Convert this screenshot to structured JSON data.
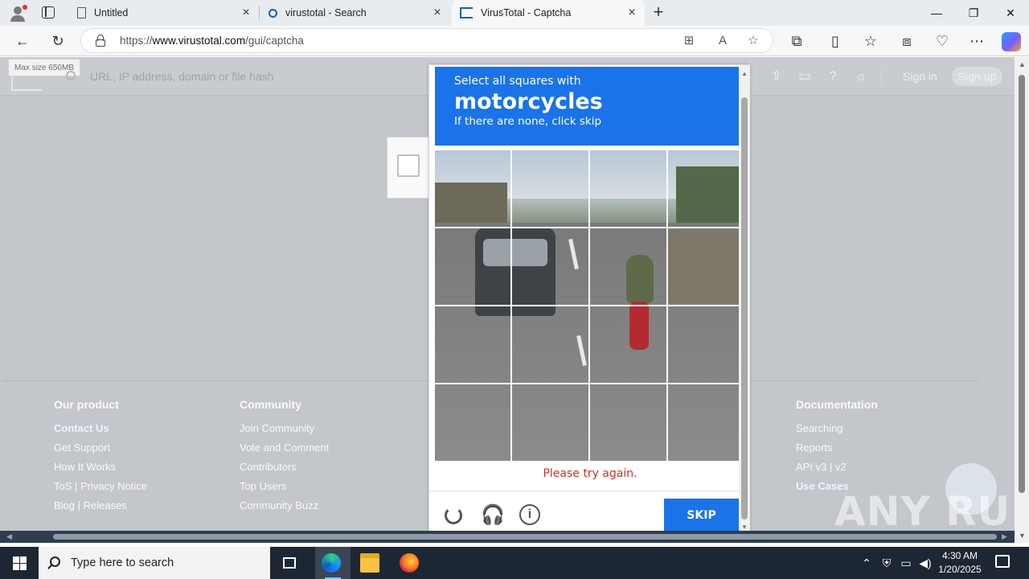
{
  "browser": {
    "tabs": [
      {
        "title": "Untitled",
        "icon": "page-icon"
      },
      {
        "title": "virustotal - Search",
        "icon": "search-icon"
      },
      {
        "title": "VirusTotal - Captcha",
        "icon": "virustotal-icon",
        "active": true
      }
    ],
    "url_prefix": "https://",
    "url_host": "www.virustotal.com",
    "url_path": "/gui/captcha",
    "window_controls": {
      "minimize": "—",
      "maximize": "❐",
      "close": "✕"
    }
  },
  "virustotal": {
    "max_size": "Max size 650MB",
    "search_placeholder": "URL, IP address, domain or file hash",
    "sign_in": "Sign in",
    "sign_up": "Sign up"
  },
  "footer": {
    "columns": [
      {
        "heading": "Our product",
        "links": [
          "Contact Us",
          "Get Support",
          "How It Works",
          "ToS | Privacy Notice",
          "Blog | Releases"
        ],
        "strong_index": 0
      },
      {
        "heading": "Community",
        "links": [
          "Join Community",
          "Vote and Comment",
          "Contributors",
          "Top Users",
          "Community Buzz"
        ]
      },
      {
        "heading": "Documentation",
        "links": [
          "Searching",
          "Reports",
          "API v3 | v2",
          "Use Cases"
        ],
        "strong_index": 3
      }
    ]
  },
  "captcha": {
    "line1": "Select all squares with",
    "target": "motorcycles",
    "line3": "If there are none, click skip",
    "error": "Please try again.",
    "skip_label": "SKIP",
    "grid": {
      "rows": 4,
      "cols": 4
    },
    "accent": "#1a73e8",
    "error_color": "#c4352a"
  },
  "watermark": "ANY RUN",
  "taskbar": {
    "search_placeholder": "Type here to search",
    "time": "4:30 AM",
    "date": "1/20/2025"
  }
}
